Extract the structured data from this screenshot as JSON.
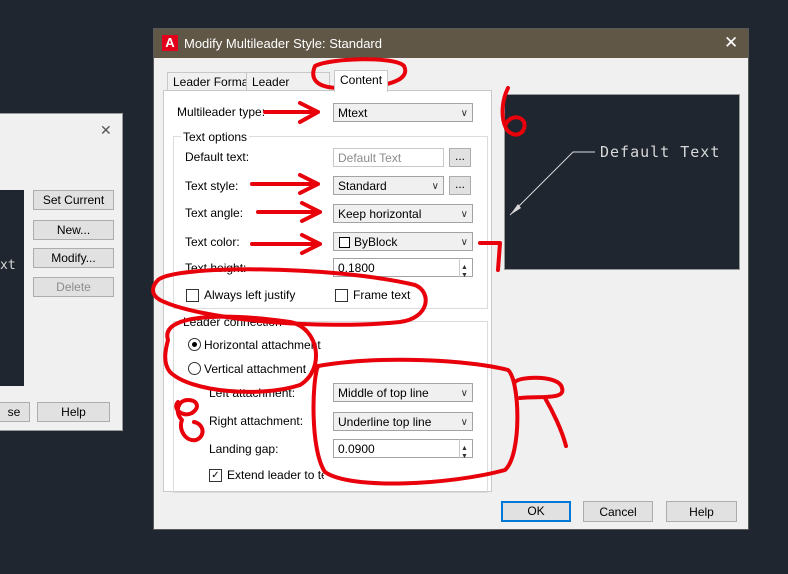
{
  "background_dialog": {
    "close_glyph": "✕",
    "preview_text": "xt",
    "buttons": {
      "set_current": "Set Current",
      "new": "New...",
      "modify": "Modify...",
      "delete": "Delete",
      "close_partial": "se",
      "help": "Help"
    }
  },
  "dialog": {
    "title": "Modify Multileader Style: Standard",
    "close_glyph": "✕",
    "tabs": [
      "Leader Format",
      "Leader Structure",
      "Content"
    ],
    "active_tab": "Content",
    "multileader_type": {
      "label": "Multileader type:",
      "value": "Mtext"
    },
    "text_options": {
      "title": "Text options",
      "default_text": {
        "label": "Default text:",
        "placeholder": "Default Text",
        "button": "..."
      },
      "text_style": {
        "label": "Text style:",
        "value": "Standard",
        "button": "..."
      },
      "text_angle": {
        "label": "Text angle:",
        "value": "Keep horizontal"
      },
      "text_color": {
        "label": "Text color:",
        "value": "ByBlock",
        "swatch_color": "#ffffff"
      },
      "text_height": {
        "label": "Text height:",
        "value": "0.1800"
      },
      "always_left_justify": {
        "label": "Always left justify",
        "checked": false
      },
      "frame_text": {
        "label": "Frame text",
        "checked": false
      }
    },
    "leader_connection": {
      "title": "Leader connection",
      "horizontal_attachment": {
        "label": "Horizontal attachment",
        "selected": true
      },
      "vertical_attachment": {
        "label": "Vertical attachment",
        "selected": false
      },
      "left_attachment": {
        "label": "Left attachment:",
        "value": "Middle of top line"
      },
      "right_attachment": {
        "label": "Right attachment:",
        "value": "Underline top line"
      },
      "landing_gap": {
        "label": "Landing gap:",
        "value": "0.0900"
      },
      "extend_leader": {
        "label": "Extend leader to text",
        "checked": true
      }
    },
    "preview": {
      "text": "Default Text"
    },
    "buttons": {
      "ok": "OK",
      "cancel": "Cancel",
      "help": "Help"
    }
  },
  "annotations": {
    "color": "#e8000b",
    "number_label": "6"
  }
}
